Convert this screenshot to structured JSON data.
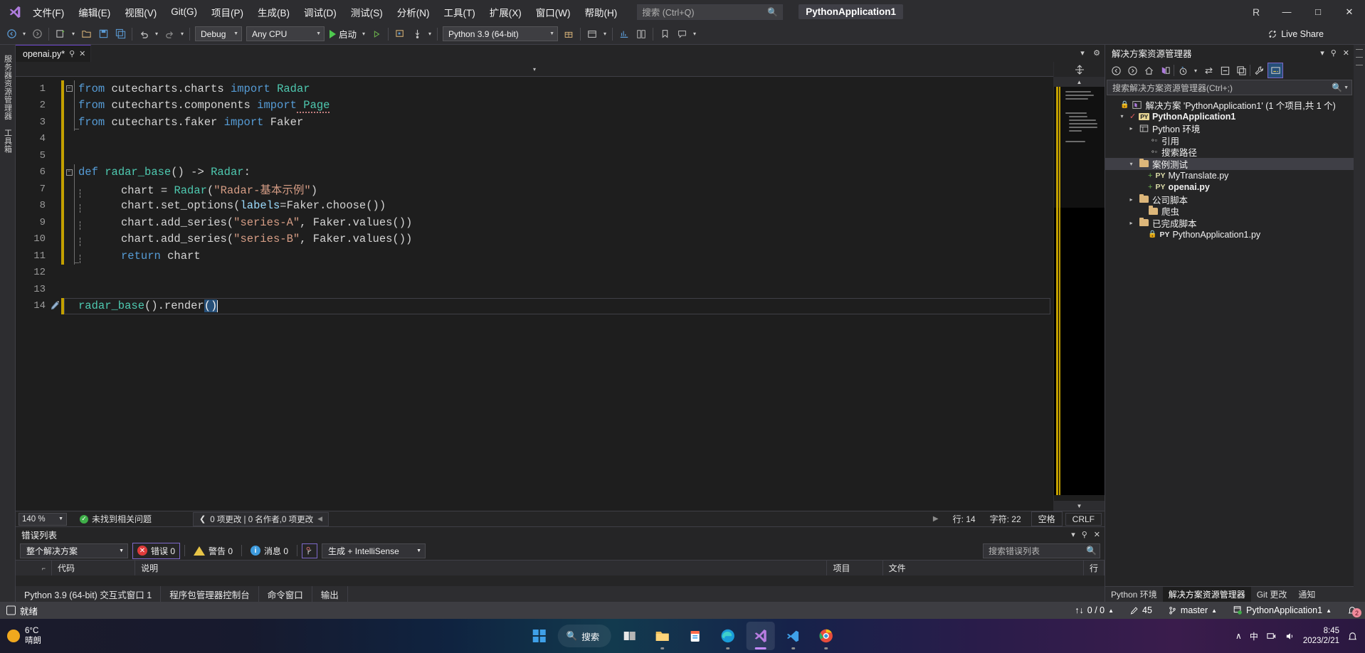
{
  "window": {
    "app_title": "PythonApplication1",
    "search_placeholder": "搜索 (Ctrl+Q)",
    "account_initial": "R",
    "minimize": "—",
    "maximize": "□",
    "close": "✕"
  },
  "menu": {
    "items": [
      {
        "label": "文件(F)"
      },
      {
        "label": "编辑(E)"
      },
      {
        "label": "视图(V)"
      },
      {
        "label": "Git(G)"
      },
      {
        "label": "项目(P)"
      },
      {
        "label": "生成(B)"
      },
      {
        "label": "调试(D)"
      },
      {
        "label": "测试(S)"
      },
      {
        "label": "分析(N)"
      },
      {
        "label": "工具(T)"
      },
      {
        "label": "扩展(X)"
      },
      {
        "label": "窗口(W)"
      },
      {
        "label": "帮助(H)"
      }
    ]
  },
  "toolbar": {
    "config": "Debug",
    "platform": "Any CPU",
    "start_label": "启动",
    "interpreter": "Python 3.9 (64-bit)",
    "live_share": "Live Share"
  },
  "left_rail": {
    "tabs": [
      "服务器资源管理器",
      "工具箱"
    ]
  },
  "editor": {
    "tab_name": "openai.py*",
    "zoom": "140 %",
    "issue_status": "未找到相关问题",
    "changes_info": "0 项更改 | 0 名作者,0 项更改",
    "line_label": "行: 14",
    "col_label": "字符: 22",
    "spaces": "空格",
    "eol": "CRLF",
    "code_lines": [
      {
        "n": "1",
        "tokens": [
          {
            "t": "from",
            "c": "kw"
          },
          {
            "t": " cutecharts.charts ",
            "c": "id"
          },
          {
            "t": "import",
            "c": "kw"
          },
          {
            "t": " Radar",
            "c": "cls"
          }
        ],
        "fold": "minus",
        "guide": "bar"
      },
      {
        "n": "2",
        "tokens": [
          {
            "t": "from",
            "c": "kw"
          },
          {
            "t": " cutecharts.components ",
            "c": "id"
          },
          {
            "t": "import",
            "c": "kw"
          },
          {
            "t": " Page",
            "c": "cls squig"
          }
        ],
        "fold": "",
        "guide": "bar"
      },
      {
        "n": "3",
        "tokens": [
          {
            "t": "from",
            "c": "kw"
          },
          {
            "t": " cutecharts.faker ",
            "c": "id"
          },
          {
            "t": "import",
            "c": "kw"
          },
          {
            "t": " Faker",
            "c": "id"
          }
        ],
        "fold": "",
        "guide": "barend"
      },
      {
        "n": "4",
        "tokens": [],
        "fold": "",
        "guide": ""
      },
      {
        "n": "5",
        "tokens": [],
        "fold": "",
        "guide": ""
      },
      {
        "n": "6",
        "tokens": [
          {
            "t": "def",
            "c": "kw"
          },
          {
            "t": " ",
            "c": "id"
          },
          {
            "t": "radar_base",
            "c": "fn"
          },
          {
            "t": "() ",
            "c": "op"
          },
          {
            "t": "->",
            "c": "op"
          },
          {
            "t": " ",
            "c": "id"
          },
          {
            "t": "Radar",
            "c": "cls"
          },
          {
            "t": ":",
            "c": "op"
          }
        ],
        "fold": "minus",
        "guide": "bar"
      },
      {
        "n": "7",
        "indent": 1,
        "tokens": [
          {
            "t": "chart ",
            "c": "id"
          },
          {
            "t": "=",
            "c": "op"
          },
          {
            "t": " ",
            "c": "id"
          },
          {
            "t": "Radar",
            "c": "cls"
          },
          {
            "t": "(",
            "c": "op"
          },
          {
            "t": "\"Radar-基本示例\"",
            "c": "str"
          },
          {
            "t": ")",
            "c": "op"
          }
        ],
        "fold": "",
        "guide": "bar"
      },
      {
        "n": "8",
        "indent": 1,
        "tokens": [
          {
            "t": "chart",
            "c": "id"
          },
          {
            "t": ".",
            "c": "op"
          },
          {
            "t": "set_options",
            "c": "id"
          },
          {
            "t": "(",
            "c": "op"
          },
          {
            "t": "labels",
            "c": "prm"
          },
          {
            "t": "=",
            "c": "op"
          },
          {
            "t": "Faker",
            "c": "id"
          },
          {
            "t": ".",
            "c": "op"
          },
          {
            "t": "choose",
            "c": "id"
          },
          {
            "t": "())",
            "c": "op"
          }
        ],
        "fold": "",
        "guide": "bar"
      },
      {
        "n": "9",
        "indent": 1,
        "tokens": [
          {
            "t": "chart",
            "c": "id"
          },
          {
            "t": ".",
            "c": "op"
          },
          {
            "t": "add_series",
            "c": "id"
          },
          {
            "t": "(",
            "c": "op"
          },
          {
            "t": "\"series-A\"",
            "c": "str"
          },
          {
            "t": ", ",
            "c": "op"
          },
          {
            "t": "Faker",
            "c": "id"
          },
          {
            "t": ".",
            "c": "op"
          },
          {
            "t": "values",
            "c": "id"
          },
          {
            "t": "())",
            "c": "op"
          }
        ],
        "fold": "",
        "guide": "bar"
      },
      {
        "n": "10",
        "indent": 1,
        "tokens": [
          {
            "t": "chart",
            "c": "id"
          },
          {
            "t": ".",
            "c": "op"
          },
          {
            "t": "add_series",
            "c": "id"
          },
          {
            "t": "(",
            "c": "op"
          },
          {
            "t": "\"series-B\"",
            "c": "str"
          },
          {
            "t": ", ",
            "c": "op"
          },
          {
            "t": "Faker",
            "c": "id"
          },
          {
            "t": ".",
            "c": "op"
          },
          {
            "t": "values",
            "c": "id"
          },
          {
            "t": "())",
            "c": "op"
          }
        ],
        "fold": "",
        "guide": "bar"
      },
      {
        "n": "11",
        "indent": 1,
        "tokens": [
          {
            "t": "return",
            "c": "kw"
          },
          {
            "t": " chart",
            "c": "id"
          }
        ],
        "fold": "",
        "guide": "barend"
      },
      {
        "n": "12",
        "tokens": [],
        "fold": "",
        "guide": ""
      },
      {
        "n": "13",
        "tokens": [],
        "fold": "",
        "guide": ""
      },
      {
        "n": "14",
        "tokens": [
          {
            "t": "radar_base",
            "c": "fn"
          },
          {
            "t": "().",
            "c": "op"
          },
          {
            "t": "render",
            "c": "id"
          },
          {
            "t": "()",
            "c": "sel"
          }
        ],
        "fold": "",
        "guide": "",
        "current": true
      }
    ]
  },
  "error_list": {
    "title": "错误列表",
    "scope": "整个解决方案",
    "errors_label": "错误 0",
    "warnings_label": "警告 0",
    "messages_label": "消息 0",
    "build_filter": "生成 + IntelliSense",
    "search_placeholder": "搜索错误列表",
    "columns": [
      "",
      "代码",
      "说明",
      "项目",
      "文件",
      "行"
    ]
  },
  "bottom_tabs": {
    "items": [
      "Python 3.9 (64-bit) 交互式窗口 1",
      "程序包管理器控制台",
      "命令窗口",
      "输出"
    ]
  },
  "solution_explorer": {
    "title": "解决方案资源管理器",
    "search_placeholder": "搜索解决方案资源管理器(Ctrl+;)",
    "tree": [
      {
        "indent": 0,
        "exp": "",
        "icon": "solution",
        "label": "解决方案 'PythonApplication1' (1 个项目,共 1 个)",
        "bold": false
      },
      {
        "indent": 1,
        "exp": "▾",
        "icon": "project",
        "label": "PythonApplication1",
        "bold": true
      },
      {
        "indent": 2,
        "exp": "▸",
        "icon": "env",
        "label": "Python 环境",
        "bold": false
      },
      {
        "indent": 3,
        "exp": "",
        "icon": "ref",
        "label": "引用",
        "bold": false
      },
      {
        "indent": 3,
        "exp": "",
        "icon": "ref",
        "label": "搜索路径",
        "bold": false
      },
      {
        "indent": 2,
        "exp": "▾",
        "icon": "folder",
        "label": "案例测试",
        "bold": false,
        "selected": true
      },
      {
        "indent": 3,
        "exp": "",
        "icon": "pyplus",
        "label": "MyTranslate.py",
        "bold": false
      },
      {
        "indent": 3,
        "exp": "",
        "icon": "pyplus",
        "label": "openai.py",
        "bold": true
      },
      {
        "indent": 2,
        "exp": "▸",
        "icon": "folder",
        "label": "公司脚本",
        "bold": false
      },
      {
        "indent": 3,
        "exp": "",
        "icon": "folder",
        "label": "爬虫",
        "bold": false
      },
      {
        "indent": 2,
        "exp": "▸",
        "icon": "folder",
        "label": "已完成脚本",
        "bold": false
      },
      {
        "indent": 3,
        "exp": "",
        "icon": "pylock",
        "label": "PythonApplication1.py",
        "bold": false
      }
    ],
    "bottom_tabs": [
      {
        "label": "Python 环境",
        "active": false
      },
      {
        "label": "解决方案资源管理器",
        "active": true
      },
      {
        "label": "Git 更改",
        "active": false
      },
      {
        "label": "通知",
        "active": false
      }
    ]
  },
  "status_bar": {
    "ready": "就绪",
    "sync": "0 / 0",
    "pencil_count": "45",
    "branch": "master",
    "repo": "PythonApplication1",
    "notif_count": "2"
  },
  "taskbar": {
    "temp": "6°C",
    "weather": "晴朗",
    "search_label": "搜索",
    "time": "8:45",
    "date": "2023/2/21",
    "ime": "中"
  },
  "colors": {
    "accent": "#6a43c9",
    "titlebar_bg": "#2d2d30",
    "editor_bg": "#1e1e1e",
    "status_bg": "#3d3d42",
    "change_bar": "#c3a000",
    "keyword": "#569cd6",
    "class": "#4ec9b0",
    "string": "#d69d85"
  }
}
